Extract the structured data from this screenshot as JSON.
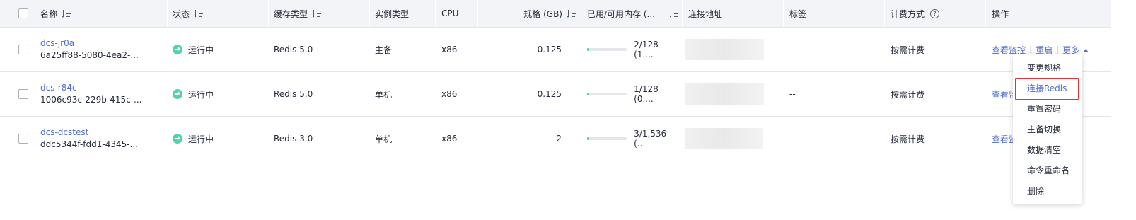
{
  "columns": {
    "name": "名称",
    "status": "状态",
    "cache_type": "缓存类型",
    "instance_type": "实例类型",
    "cpu": "CPU",
    "spec": "规格 (GB)",
    "memory": "已用/可用内存 (...",
    "address": "连接地址",
    "tags": "标签",
    "billing": "计费方式",
    "help_icon": "help-circle-icon",
    "actions": "操作"
  },
  "rows": [
    {
      "name": "dcs-jr0a",
      "id": "6a25ff88-5080-4ea2-...",
      "status": "运行中",
      "cache_type": "Redis 5.0",
      "instance_type": "主备",
      "cpu": "x86",
      "spec": "0.125",
      "memory_usage": 0.016,
      "memory_text": "2/128 (1....",
      "tags": "--",
      "billing": "按需计费",
      "action_monitor": "查看监控",
      "action_restart": "重启",
      "action_more": "更多"
    },
    {
      "name": "dcs-r84c",
      "id": "1006c93c-229b-415c-...",
      "status": "运行中",
      "cache_type": "Redis 5.0",
      "instance_type": "单机",
      "cpu": "x86",
      "spec": "0.125",
      "memory_usage": 0.008,
      "memory_text": "1/128 (0....",
      "tags": "--",
      "billing": "按需计费",
      "action_monitor": "查看监"
    },
    {
      "name": "dcs-dcstest",
      "id": "ddc5344f-fdd1-4345-...",
      "status": "运行中",
      "cache_type": "Redis 3.0",
      "instance_type": "单机",
      "cpu": "x86",
      "spec": "2",
      "memory_usage": 0.002,
      "memory_text": "3/1,536 (...",
      "tags": "--",
      "billing": "按需计费",
      "action_monitor": "查看监"
    }
  ],
  "more_menu": {
    "items": [
      "变更规格",
      "连接Redis",
      "重置密码",
      "主备切换",
      "数据清空",
      "命令重命名",
      "删除"
    ],
    "highlighted": "连接Redis"
  },
  "colors": {
    "link": "#526ecc",
    "running": "#50d4ab",
    "highlight_border": "#e0343c"
  }
}
